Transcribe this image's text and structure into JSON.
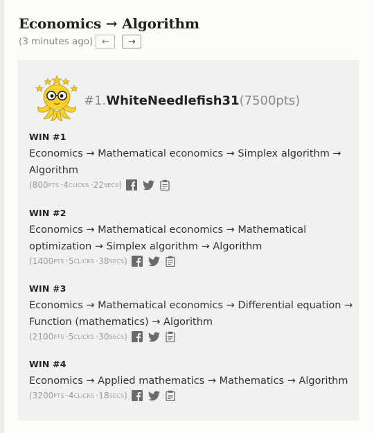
{
  "header": {
    "title": "Economics → Algorithm",
    "time_ago": "(3 minutes ago)",
    "prev_label": "←",
    "next_label": "→"
  },
  "player": {
    "rank": "#1.",
    "name": "WhiteNeedlefish31",
    "points": "(7500pts)"
  },
  "wins": [
    {
      "label": "WIN #1",
      "path": "Economics → Mathematical economics → Simplex algorithm → Algorithm",
      "open": "(",
      "points": "800",
      "points_unit": "PTS",
      "sep1": "· ",
      "clicks": "4",
      "clicks_unit": "CLICKS",
      "sep2": "· ",
      "secs": "22",
      "secs_unit": "SECS",
      "close": ")"
    },
    {
      "label": "WIN #2",
      "path": "Economics → Mathematical economics → Mathematical optimization → Simplex algorithm → Algorithm",
      "open": "(",
      "points": "1400",
      "points_unit": "PTS",
      "sep1": "· ",
      "clicks": "5",
      "clicks_unit": "CLICKS",
      "sep2": "· ",
      "secs": "38",
      "secs_unit": "SECS",
      "close": ")"
    },
    {
      "label": "WIN #3",
      "path": "Economics → Mathematical economics → Differential equation → Function (mathematics) → Algorithm",
      "open": "(",
      "points": "2100",
      "points_unit": "PTS",
      "sep1": "· ",
      "clicks": "5",
      "clicks_unit": "CLICKS",
      "sep2": "· ",
      "secs": "30",
      "secs_unit": "SECS",
      "close": ")"
    },
    {
      "label": "WIN #4",
      "path": "Economics → Applied mathematics → Mathematics → Algorithm",
      "open": "(",
      "points": "3200",
      "points_unit": "PTS",
      "sep1": "· ",
      "clicks": "4",
      "clicks_unit": "CLICKS",
      "sep2": "· ",
      "secs": "18",
      "secs_unit": "SECS",
      "close": ")"
    }
  ],
  "icons": {
    "avatar": "octopus-avatar-icon",
    "share": [
      "facebook-icon",
      "twitter-icon",
      "clipboard-icon"
    ]
  },
  "colors": {
    "panel": "#f1f1f1",
    "icon": "#6b6b6b",
    "background": "#fbfbf7"
  }
}
